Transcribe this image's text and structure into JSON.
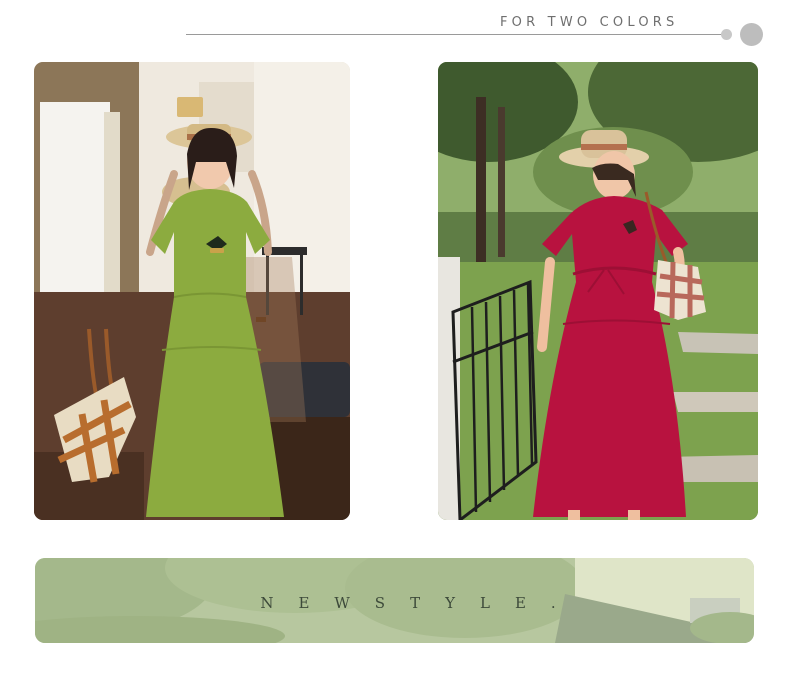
{
  "header": {
    "title": "FOR TWO COLORS"
  },
  "products": [
    {
      "name": "green",
      "color": "#8cab3f"
    },
    {
      "name": "red",
      "color": "#b8123f"
    }
  ],
  "banner": {
    "text": "NEWSTYLE."
  },
  "colors": {
    "accent_gray": "#9a9a9a",
    "dress_green": "#8cab3f",
    "dress_red": "#b8123f",
    "banner_green": "#b7c79f"
  }
}
